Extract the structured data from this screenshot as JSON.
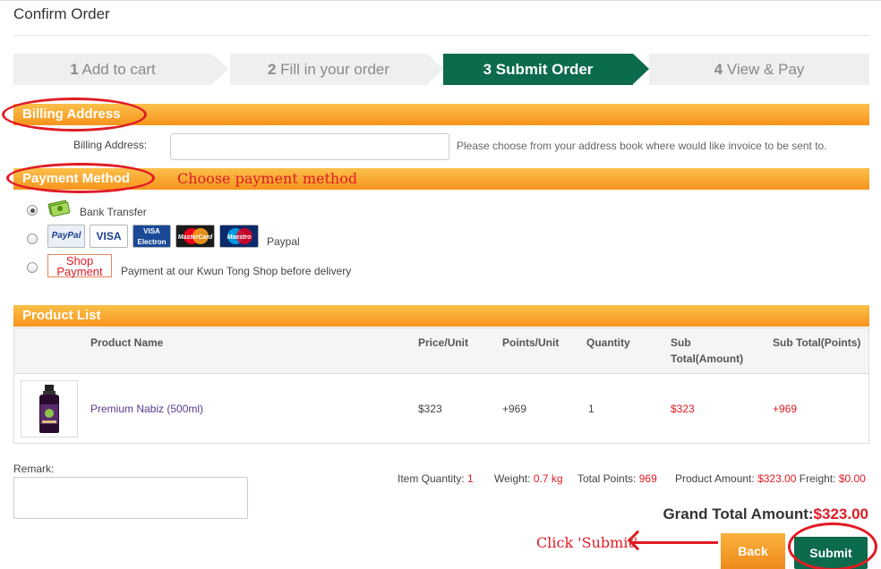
{
  "page_title": "Confirm Order",
  "steps": [
    {
      "num": "1",
      "label": "Add to cart"
    },
    {
      "num": "2",
      "label": "Fill in your order"
    },
    {
      "num": "3",
      "label": "Submit Order"
    },
    {
      "num": "4",
      "label": "View & Pay"
    }
  ],
  "billing": {
    "section_title": "Billing Address",
    "field_label": "Billing Address:",
    "field_value": "",
    "hint": "Please choose from your address book where would like invoice to be sent to."
  },
  "payment": {
    "section_title": "Payment Method",
    "annotation": "Choose payment method",
    "options": [
      {
        "label": "Bank Transfer",
        "selected": true
      },
      {
        "label": "Paypal",
        "selected": false,
        "cards": [
          "PayPal",
          "VISA",
          "VISA Electron",
          "MasterCard",
          "Maestro"
        ]
      },
      {
        "label": "Payment at our Kwun Tong Shop before delivery",
        "selected": false,
        "badge": "Shop Payment"
      }
    ]
  },
  "product_list": {
    "section_title": "Product List",
    "headers": [
      "Product Name",
      "Price/Unit",
      "Points/Unit",
      "Quantity",
      "Sub Total(Amount)",
      "Sub Total(Points)"
    ],
    "rows": [
      {
        "name": "Premium Nabiz (500ml)",
        "price": "$323",
        "points": "+969",
        "quantity": "1",
        "subtotal_amount": "$323",
        "subtotal_points": "+969"
      }
    ]
  },
  "remark": {
    "label": "Remark:",
    "value": ""
  },
  "summary": {
    "item_quantity_label": "Item Quantity:",
    "item_quantity": "1",
    "weight_label": "Weight:",
    "weight": "0.7 kg",
    "total_points_label": "Total Points:",
    "total_points": "969",
    "product_amount_label": "Product Amount:",
    "product_amount": "$323.00",
    "freight_label": "Freight:",
    "freight": "$0.00",
    "grand_total_label": "Grand Total Amount:",
    "grand_total": "$323.00"
  },
  "buttons": {
    "back": "Back",
    "submit": "Submit"
  },
  "annotation_submit": "Click 'Submit'",
  "colors": {
    "accent_green": "#0b6b4c",
    "orange": "#f7941d",
    "annotation_red": "#e01b24"
  }
}
